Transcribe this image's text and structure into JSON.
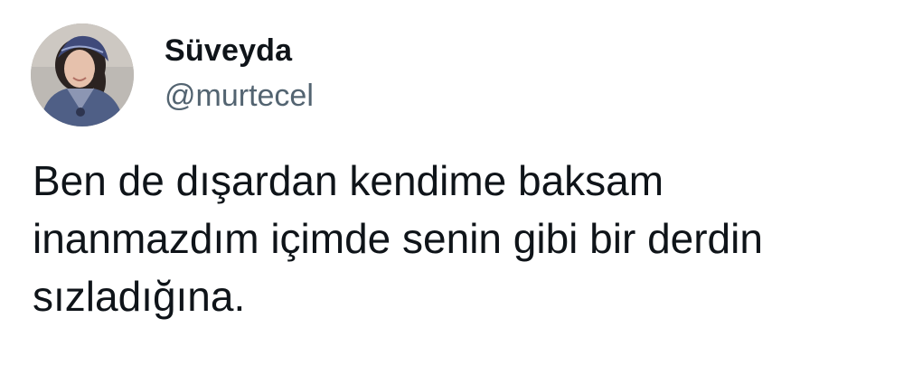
{
  "user": {
    "display_name": "Süveyda",
    "handle": "@murtecel",
    "avatar_icon": "profile-photo"
  },
  "tweet": {
    "text": "Ben de dışardan kendime baksam\ninanmazdım içimde senin gibi bir derdin\nsızladığına."
  },
  "colors": {
    "text_primary": "#0f1419",
    "text_secondary": "#536471",
    "background": "#ffffff"
  }
}
